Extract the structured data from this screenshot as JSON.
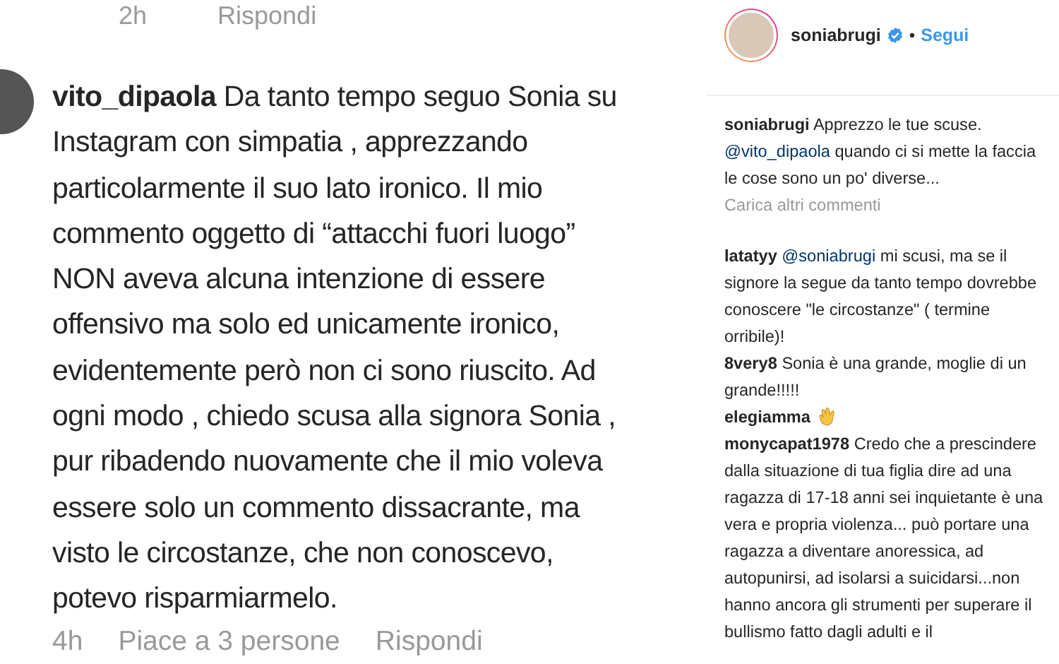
{
  "previous_comment_meta": {
    "time": "2h",
    "reply": "Rispondi"
  },
  "comment": {
    "username": "vito_dipaola",
    "lines": [
      "Da tanto tempo seguo Sonia su",
      "Instagram con simpatia , apprezzando",
      "particolarmente il suo lato ironico. Il mio",
      "commento oggetto di “attacchi fuori luogo”",
      "NON aveva alcuna intenzione di essere",
      "offensivo ma solo ed unicamente ironico,",
      "evidentemente però non ci sono riuscito. Ad",
      "ogni modo , chiedo scusa alla signora Sonia ,",
      "pur ribadendo nuovamente che  il mio voleva",
      "essere solo  un commento dissacrante, ma",
      "visto le circostanze, che non conoscevo,",
      "potevo risparmiarmelo."
    ],
    "time": "4h",
    "likes": "Piace a 3 persone",
    "reply": "Rispondi"
  },
  "post_header": {
    "username": "soniabrugi",
    "verified": true,
    "separator": "•",
    "follow": "Segui"
  },
  "caption": {
    "username": "soniabrugi",
    "text": "Apprezzo le tue scuse.",
    "mention": "@vito_dipaola",
    "rest": "quando ci si mette la faccia le cose sono un po' diverse..."
  },
  "load_more": "Carica altri commenti",
  "comments": [
    {
      "kind": "text",
      "username": "latatyy",
      "mention": "@soniabrugi",
      "text": "mi scusi, ma se il signore la segue da tanto tempo dovrebbe conoscere \"le circostanze\" ( termine orribile)!"
    },
    {
      "kind": "text",
      "username": "8very8",
      "text": "Sonia è una grande, moglie di un grande!!!!!"
    },
    {
      "kind": "emoji",
      "username": "elegiamma"
    },
    {
      "kind": "text",
      "username": "monycapat1978",
      "text": "Credo che a prescindere dalla situazione di tua figlia dire ad una ragazza di 17-18 anni sei inquietante è una vera e propria violenza... può portare una ragazza a diventare anoressica, ad autopunirsi, ad isolarsi a suicidarsi...non hanno ancora gli strumenti per superare il bullismo fatto dagli adulti e il"
    }
  ]
}
